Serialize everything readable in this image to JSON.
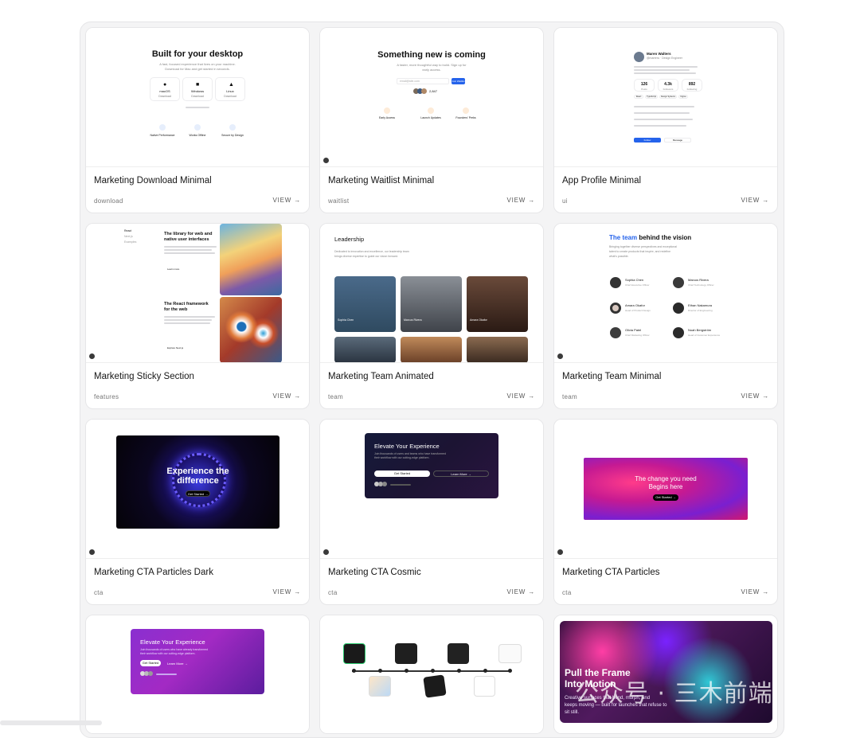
{
  "cards": [
    {
      "title": "Marketing Download Minimal",
      "tag": "download",
      "view": "VIEW",
      "preview": {
        "heading": "Built for your desktop",
        "sub1": "A fast, focused experience that lives on your machine.",
        "sub2": "Download for Mac and get started in seconds.",
        "platforms": [
          "macOS",
          "Windows",
          "Linux"
        ],
        "download": "Download",
        "features": [
          "Native Performance",
          "Works Offline",
          "Secure by Design"
        ]
      }
    },
    {
      "title": "Marketing Waitlist Minimal",
      "tag": "waitlist",
      "view": "VIEW",
      "preview": {
        "heading": "Something new is coming",
        "sub1": "A faster, more thoughtful way to build. Sign up for",
        "sub2": "early access.",
        "input_placeholder": "email@site.com",
        "button": "Join Waitlist",
        "count": "2,847",
        "features": [
          "Early Access",
          "Launch Updates",
          "Founders' Perks"
        ]
      }
    },
    {
      "title": "App Profile Minimal",
      "tag": "ui",
      "view": "VIEW",
      "preview": {
        "name": "Maren Walters",
        "handle": "@marenw · Design Engineer",
        "stats": [
          "126",
          "4.3k",
          "892"
        ],
        "stat_labels": [
          "Posts",
          "Followers",
          "Following"
        ],
        "tags": [
          "React",
          "TypeScript",
          "Design Systems",
          "Figma"
        ],
        "follow": "Follow",
        "message": "Message"
      }
    },
    {
      "title": "Marketing Sticky Section",
      "tag": "features",
      "view": "VIEW",
      "preview": {
        "nav": [
          "React",
          "Next.js",
          "Examples"
        ],
        "h1": "The library for web and native user interfaces",
        "learn": "Learn more",
        "h2": "The React framework for the web",
        "explore": "Explore Next.js"
      }
    },
    {
      "title": "Marketing Team Animated",
      "tag": "team",
      "view": "VIEW",
      "preview": {
        "heading": "Leadership",
        "sub1": "Dedicated to innovation and excellence, our leadership team",
        "sub2": "brings diverse expertise to guide our vision forward.",
        "people": [
          "Sophia Chen",
          "Marcus Rivera",
          "Amara Okafor"
        ]
      }
    },
    {
      "title": "Marketing Team Minimal",
      "tag": "team",
      "view": "VIEW",
      "preview": {
        "heading_accent": "The team",
        "heading_rest": " behind the vision",
        "sub1": "Bringing together diverse perspectives and exceptional",
        "sub2": "talent to create products that inspire, and redefine",
        "sub3": "what's possible.",
        "people": [
          {
            "name": "Sophia Chen",
            "role": "Chief Executive Officer"
          },
          {
            "name": "Marcus Rivera",
            "role": "Chief Technology Officer"
          },
          {
            "name": "Amara Okafor",
            "role": "Head of Product Design"
          },
          {
            "name": "Ethan Nakamura",
            "role": "Director of Engineering"
          },
          {
            "name": "Olivia Patel",
            "role": "Chief Marketing Officer"
          },
          {
            "name": "Noah Bergström",
            "role": "Head of Customer Experience"
          }
        ]
      }
    },
    {
      "title": "Marketing CTA Particles Dark",
      "tag": "cta",
      "view": "VIEW",
      "preview": {
        "line1": "Experience the",
        "line2": "difference",
        "button": "Get Started"
      }
    },
    {
      "title": "Marketing CTA Cosmic",
      "tag": "cta",
      "view": "VIEW",
      "preview": {
        "heading": "Elevate Your Experience",
        "sub1": "Join thousands of users and teams who have transformed",
        "sub2": "their workflow with our cutting-edge platform.",
        "primary": "Get Started",
        "secondary": "Learn More"
      }
    },
    {
      "title": "Marketing CTA Particles",
      "tag": "cta",
      "view": "VIEW",
      "preview": {
        "line1": "The change you need",
        "line2": "Begins here",
        "button": "Get Started"
      }
    },
    {
      "title": "",
      "tag": "",
      "view": "",
      "preview": {
        "heading": "Elevate Your Experience",
        "sub1": "Join thousands of users who have already transformed",
        "sub2": "their workflow with our cutting-edge platform.",
        "primary": "Get Started",
        "secondary": "Learn More"
      }
    },
    {
      "title": "",
      "tag": "",
      "view": "",
      "preview": {}
    },
    {
      "title": "",
      "tag": "",
      "view": "",
      "preview": {
        "heading1": "Pull the Frame",
        "heading2": "Into Motion",
        "body1": "Creative surfaces that bend, morph, and",
        "body2": "keeps moving — built for launches that refuse to",
        "body3": "sit still."
      }
    }
  ],
  "watermark": "公众号 · 三木前端"
}
